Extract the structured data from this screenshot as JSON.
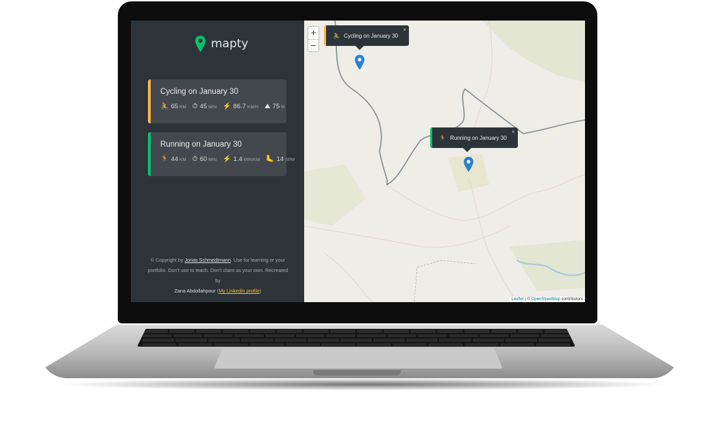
{
  "app": {
    "logo_text": "mapty",
    "colors": {
      "cycling": "#ffb545",
      "running": "#00c46a",
      "sidebar": "#2d3439",
      "card": "#42484d"
    }
  },
  "workouts": [
    {
      "type": "cycling",
      "title": "Cycling on January 30",
      "icon": "cyclist-icon",
      "distance": "65",
      "distance_unit": "KM",
      "duration": "45",
      "duration_unit": "MIN",
      "pace_or_speed": "86.7",
      "pace_or_speed_unit": "KM/H",
      "cadence_or_elev": "75",
      "cadence_or_elev_unit": "M"
    },
    {
      "type": "running",
      "title": "Running on January 30",
      "icon": "runner-icon",
      "distance": "44",
      "distance_unit": "KM",
      "duration": "60",
      "duration_unit": "MIN",
      "pace_or_speed": "1.4",
      "pace_or_speed_unit": "MIN/KM",
      "cadence_or_elev": "14",
      "cadence_or_elev_unit": "SPM"
    }
  ],
  "footer": {
    "prefix": "© Copyright by ",
    "author": "Jonas Schmedtmann",
    "middle": ". Use for learning or your portfolio. Don't use to teach. Don't claim as your own. Recreated by",
    "recreator": "Zana Abdollahpour",
    "linkedin": "My Linkedin profile"
  },
  "map": {
    "zoom_in": "+",
    "zoom_out": "−",
    "popups": [
      {
        "text": "Cycling on January 30",
        "close": "×"
      },
      {
        "text": "Running on January 30",
        "close": "×"
      }
    ],
    "attribution": {
      "leaflet": "Leaflet",
      "sep": " | © ",
      "osm": "OpenStreetMap",
      "suffix": " contributors"
    }
  }
}
